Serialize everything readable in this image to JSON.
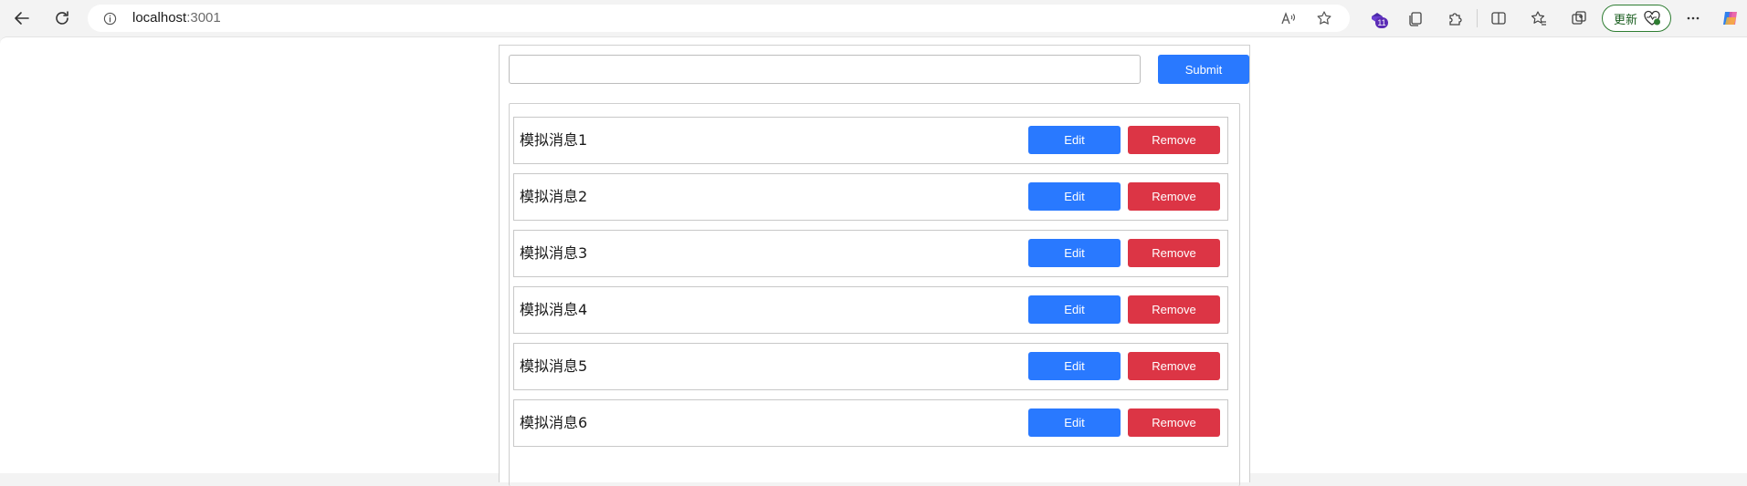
{
  "browser": {
    "url_host": "localhost",
    "url_port": ":3001",
    "extension_badge": "11",
    "update_label": "更新"
  },
  "form": {
    "input_value": "",
    "submit_label": "Submit"
  },
  "messages": [
    {
      "text": "模拟消息1",
      "edit_label": "Edit",
      "remove_label": "Remove"
    },
    {
      "text": "模拟消息2",
      "edit_label": "Edit",
      "remove_label": "Remove"
    },
    {
      "text": "模拟消息3",
      "edit_label": "Edit",
      "remove_label": "Remove"
    },
    {
      "text": "模拟消息4",
      "edit_label": "Edit",
      "remove_label": "Remove"
    },
    {
      "text": "模拟消息5",
      "edit_label": "Edit",
      "remove_label": "Remove"
    },
    {
      "text": "模拟消息6",
      "edit_label": "Edit",
      "remove_label": "Remove"
    }
  ],
  "colors": {
    "primary": "#2979ff",
    "danger": "#dc3545"
  }
}
